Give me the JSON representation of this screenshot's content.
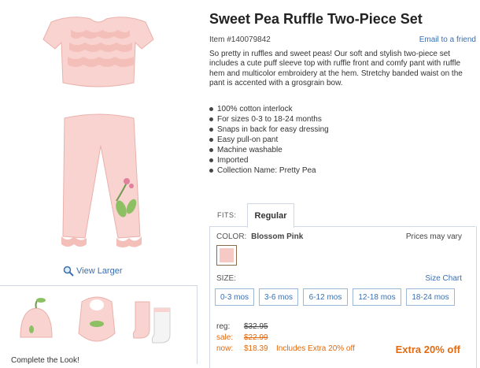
{
  "product": {
    "title": "Sweet Pea Ruffle Two-Piece Set",
    "item_number": "Item #140079842",
    "email_link": "Email to a friend",
    "description": "So pretty in ruffles and sweet peas! Our soft and stylish two-piece set includes a cute puff sleeve top with ruffle front and comfy pant with ruffle hem and multicolor embroidery at the hem. Stretchy banded waist on the pant is accented with a grosgrain bow.",
    "features": [
      "100% cotton interlock",
      "For sizes 0-3 to 18-24 months",
      "Snaps in back for easy dressing",
      "Easy pull-on pant",
      "Machine washable",
      "Imported",
      "Collection Name: Pretty Pea"
    ]
  },
  "image": {
    "view_larger": "View Larger",
    "complete_the_look": "Complete the Look!"
  },
  "fits": {
    "label": "FITS:",
    "selected_tab": "Regular"
  },
  "color": {
    "label": "COLOR:",
    "selected": "Blossom Pink",
    "prices_vary": "Prices may vary",
    "swatch_color": "#f7c9c5"
  },
  "size": {
    "label": "SIZE:",
    "chart_link": "Size Chart",
    "options": [
      "0-3 mos",
      "3-6 mos",
      "6-12 mos",
      "12-18 mos",
      "18-24 mos"
    ]
  },
  "pricing": {
    "reg_label": "reg:",
    "reg_value": "$32.95",
    "sale_label": "sale:",
    "sale_value": "$22.99",
    "now_label": "now:",
    "now_value": "$18.39",
    "now_extra": "Includes Extra 20% off",
    "extra_off": "Extra 20% off"
  },
  "colors": {
    "link": "#3a6fb0",
    "accent_orange": "#e06b12",
    "border": "#cfd8e3",
    "product_pink": "#f9d3cf"
  }
}
